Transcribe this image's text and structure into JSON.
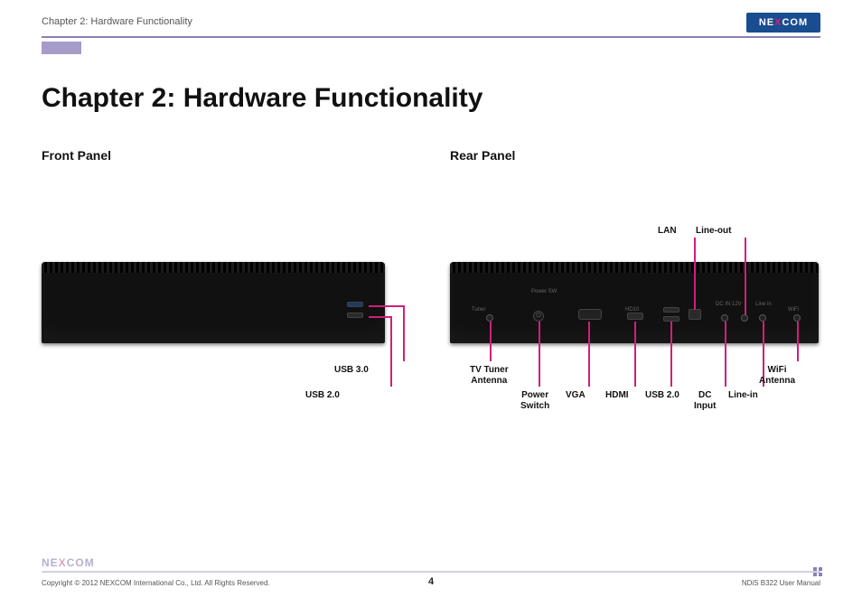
{
  "header": {
    "breadcrumb": "Chapter 2: Hardware Functionality",
    "logo_pre": "NE",
    "logo_x": "X",
    "logo_post": "COM"
  },
  "title": "Chapter 2: Hardware Functionality",
  "front": {
    "heading": "Front Panel",
    "labels": {
      "usb30": "USB 3.0",
      "usb20": "USB 2.0"
    }
  },
  "rear": {
    "heading": "Rear Panel",
    "labels_top": {
      "lan": "LAN",
      "lineout": "Line-out"
    },
    "labels_bottom": {
      "tvtuner": "TV Tuner\nAntenna",
      "power": "Power\nSwitch",
      "vga": "VGA",
      "hdmi": "HDMI",
      "usb20": "USB 2.0",
      "dc": "DC\nInput",
      "linein": "Line-in",
      "wifi": "WiFi\nAntenna"
    },
    "silkscreen": {
      "power_sw": "Power SW",
      "tuner": "Tuner",
      "hd10": "HD10",
      "dc_in": "DC IN\n12V",
      "line_in": "Line\nin",
      "wifi": "WiFi"
    }
  },
  "footer": {
    "logo_pre": "NE",
    "logo_x": "X",
    "logo_post": "COM",
    "copyright": "Copyright © 2012 NEXCOM International Co., Ltd. All Rights Reserved.",
    "page": "4",
    "doc": "NDiS B322 User Manual"
  }
}
